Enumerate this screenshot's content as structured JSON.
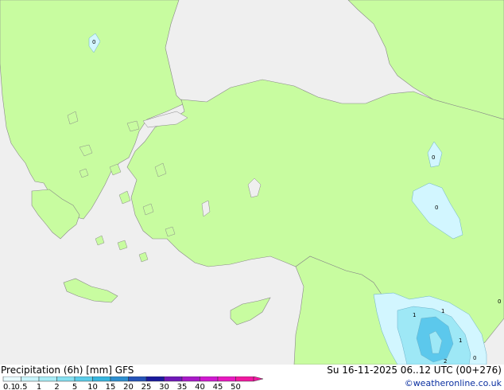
{
  "footer": {
    "title": "Precipitation (6h) [mm] GFS",
    "time_info": "Su 16-11-2025 06..12 UTC (00+276)",
    "credit": "©weatheronline.co.uk"
  },
  "legend": {
    "ticks": [
      "0.1",
      "0.5",
      "1",
      "2",
      "5",
      "10",
      "15",
      "20",
      "25",
      "30",
      "35",
      "40",
      "45",
      "50"
    ],
    "colors": [
      "#e8fbff",
      "#c8f4fb",
      "#a8ecf6",
      "#86e0f1",
      "#5ccde9",
      "#38b6df",
      "#2e8fd0",
      "#2453b8",
      "#1a1a9c",
      "#7018b8",
      "#a818c8",
      "#d018d0",
      "#e818c0",
      "#f018a0"
    ]
  },
  "map_colors": {
    "sea": "#efefef",
    "land_precip_free": "#c8fca0",
    "precip_light": "#d2f6ff",
    "precip_moderate": "#9ee8f6",
    "precip_heavy": "#5cc8ec"
  },
  "map_labels": [
    "0",
    "0",
    "0",
    "1",
    "1",
    "1",
    "2",
    "0",
    "0"
  ]
}
